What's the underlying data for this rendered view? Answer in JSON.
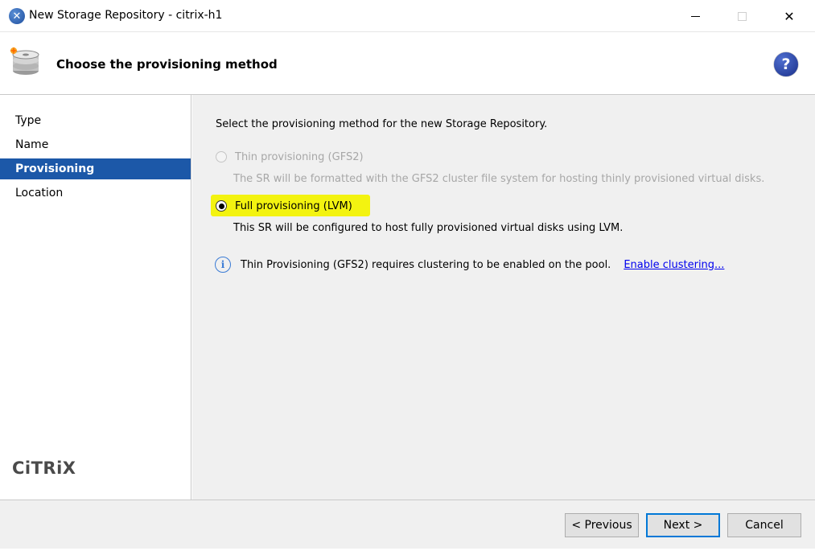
{
  "window": {
    "title": "New Storage Repository - citrix-h1",
    "minimize": "—",
    "close": "✕"
  },
  "header": {
    "title": "Choose the provisioning method",
    "help": "?"
  },
  "nav": {
    "items": [
      {
        "label": "Type"
      },
      {
        "label": "Name"
      },
      {
        "label": "Provisioning"
      },
      {
        "label": "Location"
      }
    ],
    "active_index": 2,
    "logo": "CiTRiX"
  },
  "content": {
    "intro": "Select the provisioning method for the new Storage Repository.",
    "options": [
      {
        "label": "Thin provisioning (GFS2)",
        "description": "The SR will be formatted with the GFS2 cluster file system for hosting thinly provisioned virtual disks.",
        "enabled": false,
        "selected": false
      },
      {
        "label": "Full provisioning (LVM)",
        "description": "This SR will be configured to host fully provisioned virtual disks using LVM.",
        "enabled": true,
        "selected": true
      }
    ],
    "info": {
      "icon": "i",
      "text": "Thin Provisioning (GFS2) requires clustering to be enabled on the pool.",
      "link": "Enable clustering..."
    }
  },
  "footer": {
    "previous": "< Previous",
    "next": "Next >",
    "cancel": "Cancel"
  },
  "colors": {
    "accent": "#1c58a8",
    "highlight": "#f3f310",
    "link": "#0000ee"
  }
}
